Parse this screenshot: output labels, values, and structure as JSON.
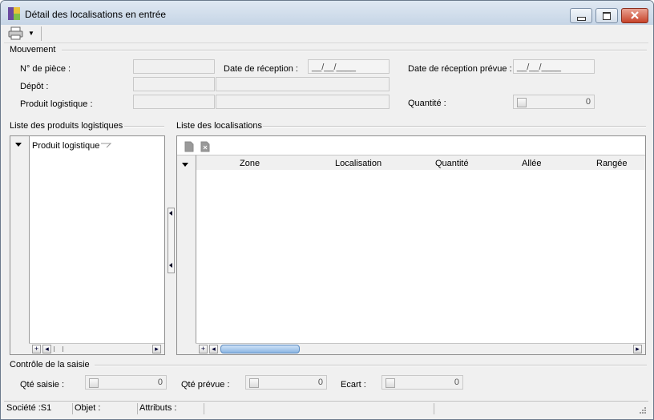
{
  "window": {
    "title": "Détail des localisations en entrée"
  },
  "toolbar": {
    "dropdown_arrow": "▼"
  },
  "mouvement": {
    "group_label": "Mouvement",
    "num_piece_label": "N° de pièce :",
    "date_reception_label": "Date de réception :",
    "date_reception_value": "__/__/____",
    "date_prevue_label": "Date de réception prévue :",
    "date_prevue_value": "__/__/____",
    "depot_label": "Dépôt :",
    "produit_label": "Produit logistique :",
    "quantite_label": "Quantité :",
    "quantite_value": "0"
  },
  "produits": {
    "group_label": "Liste des produits logistiques",
    "column": "Produit logistique"
  },
  "localisations": {
    "group_label": "Liste des localisations",
    "columns": [
      "Zone",
      "Localisation",
      "Quantité",
      "Allée",
      "Rangée"
    ]
  },
  "controle": {
    "group_label": "Contrôle de la saisie",
    "qte_saisie_label": "Qté saisie :",
    "qte_saisie_value": "0",
    "qte_prevue_label": "Qté prévue :",
    "qte_prevue_value": "0",
    "ecart_label": "Ecart :",
    "ecart_value": "0"
  },
  "statusbar": {
    "societe": "Société :S1",
    "objet": "Objet :",
    "attributs": "Attributs :"
  }
}
